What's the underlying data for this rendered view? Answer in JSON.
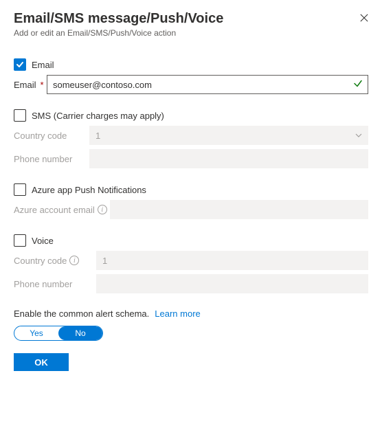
{
  "header": {
    "title": "Email/SMS message/Push/Voice",
    "subtitle": "Add or edit an Email/SMS/Push/Voice action"
  },
  "email": {
    "checkbox_label": "Email",
    "checked": true,
    "field_label": "Email",
    "value": "someuser@contoso.com"
  },
  "sms": {
    "checkbox_label": "SMS (Carrier charges may apply)",
    "checked": false,
    "country_label": "Country code",
    "country_value": "1",
    "phone_label": "Phone number",
    "phone_value": ""
  },
  "push": {
    "checkbox_label": "Azure app Push Notifications",
    "checked": false,
    "field_label": "Azure account email",
    "value": ""
  },
  "voice": {
    "checkbox_label": "Voice",
    "checked": false,
    "country_label": "Country code",
    "country_value": "1",
    "phone_label": "Phone number",
    "phone_value": ""
  },
  "schema": {
    "text": "Enable the common alert schema.",
    "learn": "Learn more",
    "yes": "Yes",
    "no": "No",
    "selected": "No"
  },
  "buttons": {
    "ok": "OK"
  }
}
